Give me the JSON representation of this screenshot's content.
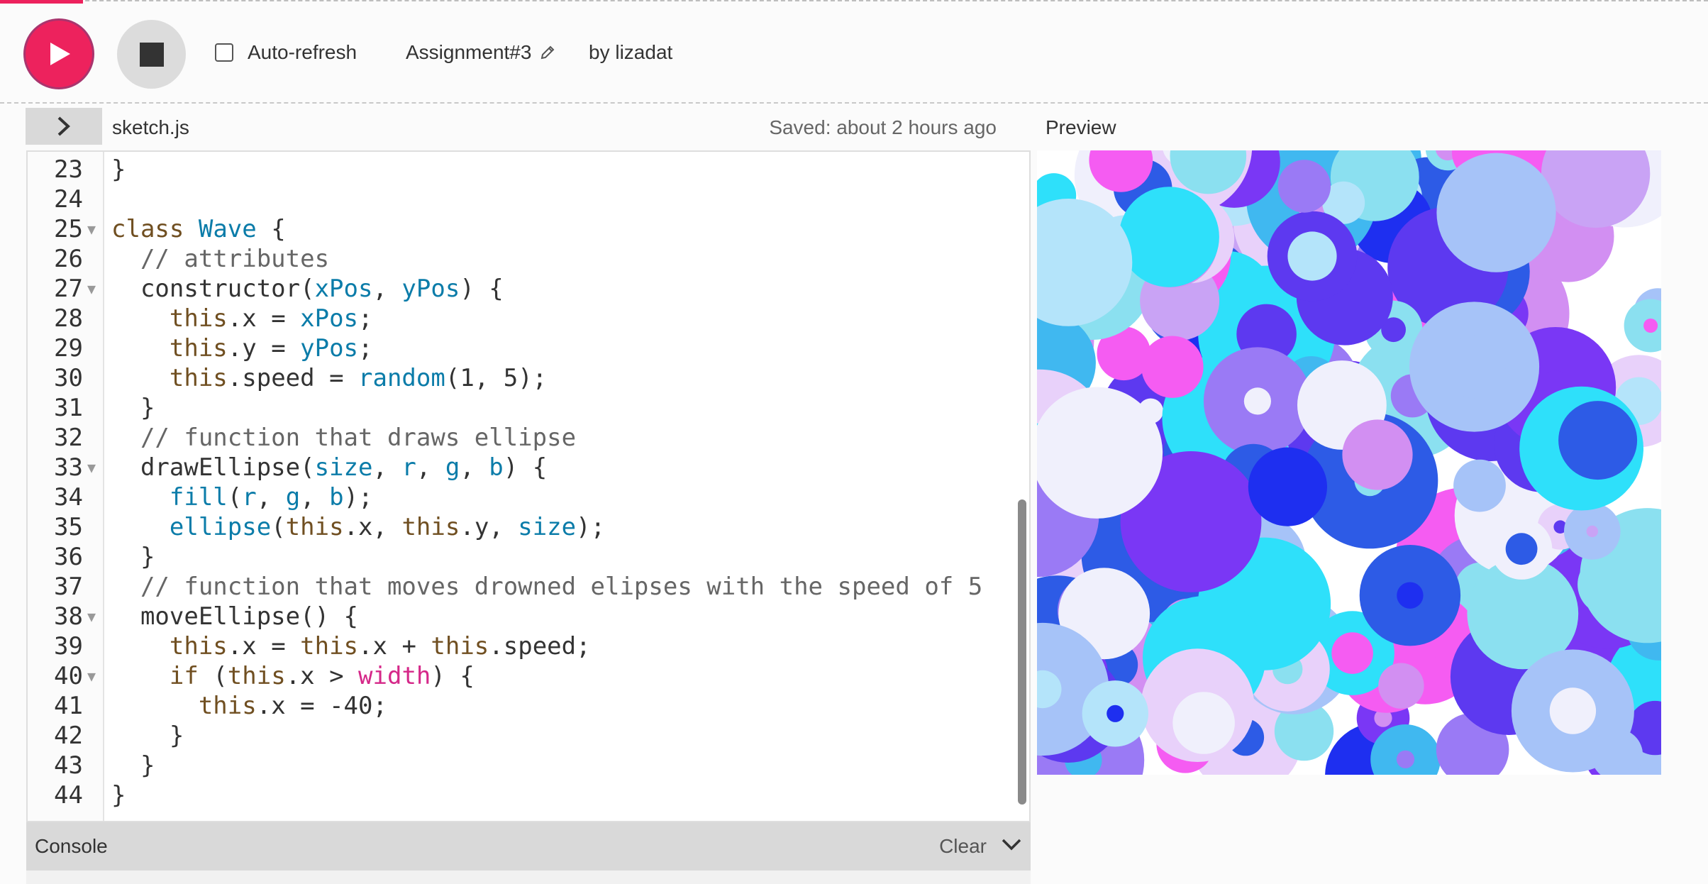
{
  "toolbar": {
    "play_icon": "play-icon",
    "stop_icon": "stop-icon",
    "autorefresh_label": "Auto-refresh",
    "autorefresh_checked": false,
    "project_name": "Assignment#3",
    "edit_icon": "pencil-icon",
    "byline": "by lizadat",
    "accent": "#ed225d"
  },
  "editor": {
    "toggle_icon": "chevron-right-icon",
    "filename": "sketch.js",
    "saved_status": "Saved: about 2 hours ago",
    "lines": [
      {
        "n": "23",
        "text": "}"
      },
      {
        "n": "24",
        "text": ""
      },
      {
        "n": "25",
        "text": "class Wave {"
      },
      {
        "n": "26",
        "text": "  // attributes"
      },
      {
        "n": "27",
        "text": "  constructor(xPos, yPos) {"
      },
      {
        "n": "28",
        "text": "    this.x = xPos;"
      },
      {
        "n": "29",
        "text": "    this.y = yPos;"
      },
      {
        "n": "30",
        "text": "    this.speed = random(1, 5);"
      },
      {
        "n": "31",
        "text": "  }"
      },
      {
        "n": "32",
        "text": "  // function that draws ellipse"
      },
      {
        "n": "33",
        "text": "  drawEllipse(size, r, g, b) {"
      },
      {
        "n": "34",
        "text": "    fill(r, g, b);"
      },
      {
        "n": "35",
        "text": "    ellipse(this.x, this.y, size);"
      },
      {
        "n": "36",
        "text": "  }"
      },
      {
        "n": "37",
        "text": "  // function that moves drowned elipses with the speed of 5"
      },
      {
        "n": "38",
        "text": "  moveEllipse() {"
      },
      {
        "n": "39",
        "text": "    this.x = this.x + this.speed;"
      },
      {
        "n": "40",
        "text": "    if (this.x > width) {"
      },
      {
        "n": "41",
        "text": "      this.x = -40;"
      },
      {
        "n": "42",
        "text": "    }"
      },
      {
        "n": "43",
        "text": "  }"
      },
      {
        "n": "44",
        "text": "}"
      }
    ],
    "fold_lines": [
      "25",
      "27",
      "33",
      "38",
      "40"
    ]
  },
  "preview": {
    "label": "Preview",
    "palette": [
      "#d28ff2",
      "#2d5be6",
      "#8be0f0",
      "#c9a3f5",
      "#f55cf2",
      "#40b8f0",
      "#7a37f5",
      "#b4e4fa",
      "#2ee0fa",
      "#e8d1fa",
      "#5d39f0",
      "#a6c3f8",
      "#1e2ff0",
      "#9a7af5",
      "#f0f0fc"
    ]
  },
  "console": {
    "title": "Console",
    "clear_label": "Clear",
    "collapse_icon": "chevron-down-icon"
  }
}
